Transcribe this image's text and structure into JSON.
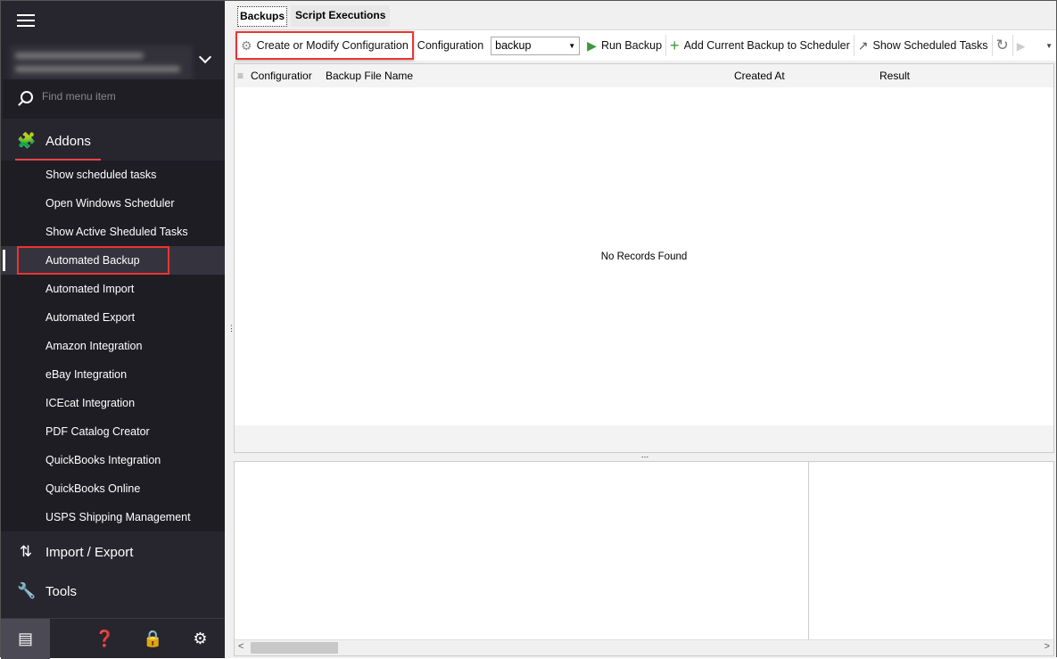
{
  "sidebar": {
    "search_placeholder": "Find menu item",
    "sections": {
      "addons": "Addons",
      "import_export": "Import / Export",
      "tools": "Tools"
    },
    "addon_items": [
      "Show scheduled tasks",
      "Open Windows Scheduler",
      "Show Active Sheduled Tasks",
      "Automated Backup",
      "Automated Import",
      "Automated Export",
      "Amazon Integration",
      "eBay Integration",
      "ICEcat Integration",
      "PDF Catalog Creator",
      "QuickBooks Integration",
      "QuickBooks Online",
      "USPS Shipping Management"
    ],
    "active_item": "Automated Backup"
  },
  "tabs": [
    "Backups",
    "Script Executions"
  ],
  "toolbar": {
    "create": "Create or Modify Configuration",
    "config_label": "Configuration",
    "config_value": "backup",
    "run": "Run Backup",
    "add": "Add Current Backup to Scheduler",
    "show": "Show Scheduled Tasks"
  },
  "grid": {
    "columns": [
      "Configuratior",
      "Backup File Name",
      "Created At",
      "Result"
    ],
    "empty": "No Records Found"
  },
  "colors": {
    "sidebar_bg": "#27262f",
    "accent": "#f0434a",
    "highlight": "#e33333"
  }
}
